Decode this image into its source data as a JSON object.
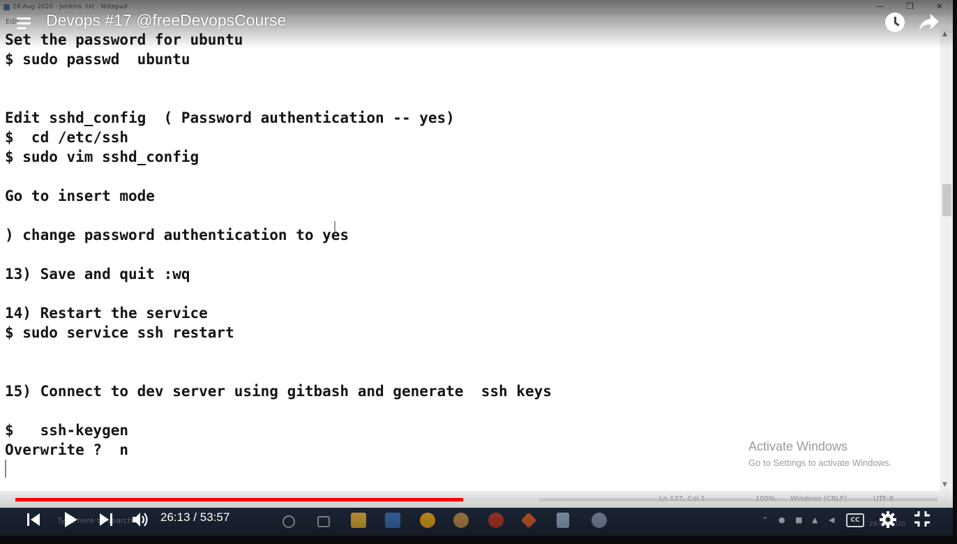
{
  "notepad": {
    "window_title": "28-Aug-2020 - Jenkins .txt - Notepad",
    "menu_edit": "Edit",
    "lines": [
      "Set the password for ubuntu",
      "$ sudo passwd  ubuntu",
      "",
      "",
      "Edit sshd_config  ( Password authentication -- yes)",
      "$  cd /etc/ssh",
      "$ sudo vim sshd_config",
      "",
      "Go to insert mode",
      "",
      ") change password authentication to yes",
      "",
      "13) Save and quit :wq",
      "",
      "14) Restart the service",
      "$ sudo service ssh restart",
      "",
      "",
      "15) Connect to dev server using gitbash and generate  ssh keys",
      "",
      "$   ssh-keygen",
      "Overwrite ?  n"
    ],
    "status": {
      "position": "Ln 127, Col 1",
      "zoom": "100%",
      "line_ending": "Windows (CRLF)",
      "encoding": "UTF-8"
    },
    "scroll_fraction": 0.35
  },
  "watermark": {
    "title": "Activate Windows",
    "subtitle": "Go to Settings to activate Windows."
  },
  "player": {
    "title": "Devops #17 @freeDevopsCourse",
    "current_time": "26:13",
    "separator": "/",
    "duration": "53:57",
    "played_fraction": 0.486,
    "loaded_fraction": 0.568,
    "colors": {
      "progress_played": "#ff0000",
      "text": "#ffffff"
    },
    "icons": [
      "menu-icon",
      "clock-icon",
      "share-icon",
      "previous-icon",
      "play-icon",
      "next-icon",
      "volume-icon",
      "captions-icon",
      "gear-icon",
      "fullscreen-exit-icon"
    ],
    "captions_label": "CC"
  },
  "taskbar": {
    "search_placeholder": "Type here to search",
    "date": "28-08-2020"
  }
}
